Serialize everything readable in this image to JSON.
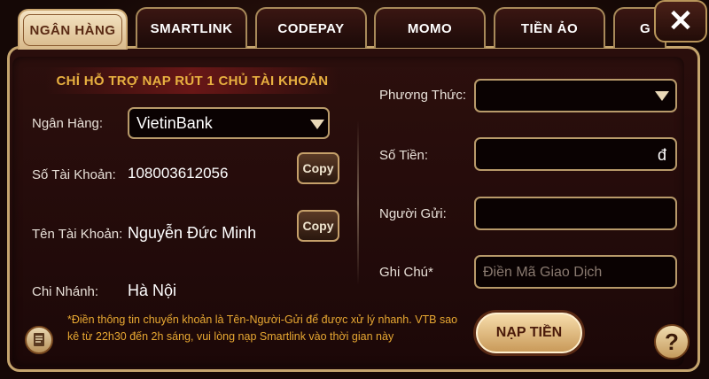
{
  "tabs": [
    {
      "label": "NGÂN HÀNG",
      "active": true
    },
    {
      "label": "SMARTLINK"
    },
    {
      "label": "CODEPAY"
    },
    {
      "label": "MOMO"
    },
    {
      "label": "TIỀN ẢO"
    },
    {
      "label": "G"
    }
  ],
  "close_label": "✕",
  "notice": "CHỈ HỖ TRỢ NẠP RÚT 1 CHỦ TÀI KHOẢN",
  "left": {
    "bank_label": "Ngân Hàng:",
    "bank_value": "VietinBank",
    "account_number_label": "Số Tài Khoản:",
    "account_number": "108003612056",
    "account_name_label": "Tên Tài Khoản:",
    "account_name": "Nguyễn Đức Minh",
    "branch_label": "Chi Nhánh:",
    "branch": "Hà Nội",
    "copy_label": "Copy"
  },
  "right": {
    "method_label": "Phương Thức:",
    "amount_label": "Số Tiền:",
    "currency_symbol": "đ",
    "sender_label": "Người Gửi:",
    "note_label": "Ghi Chú*",
    "note_placeholder": "Điền Mã Giao Dịch"
  },
  "footer_note": "*Điền thông tin chuyển khoản là Tên-Người-Gửi để được xử lý nhanh. VTB sao kê từ 22h30 đến 2h sáng, vui lòng nạp Smartlink vào thời gian này",
  "submit_label": "NẠP TIỀN",
  "help_label": "?"
}
